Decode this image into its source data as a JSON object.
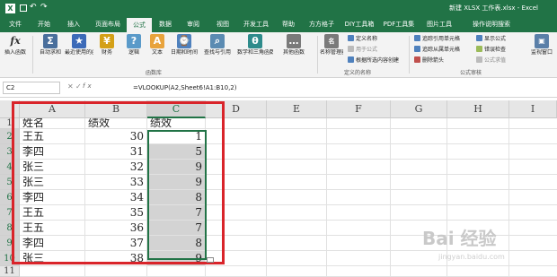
{
  "window": {
    "title": "新建 XLSX 工作表.xlsx - Excel",
    "user": "登录"
  },
  "tabs": [
    "文件",
    "开始",
    "插入",
    "页面布局",
    "公式",
    "数据",
    "审阅",
    "视图",
    "开发工具",
    "帮助",
    "方方格子",
    "DIY工具箱",
    "PDF工具集",
    "图片工具",
    "操作说明搜索"
  ],
  "ribbon": {
    "insert_function": "插入函数",
    "function_library": {
      "group_label": "函数库",
      "buttons": [
        "自动求和",
        "最近使用的函数",
        "财务",
        "逻辑",
        "文本",
        "日期和时间",
        "查找与引用",
        "数学和三角函数",
        "其他函数"
      ]
    },
    "defined_names": {
      "group_label": "定义的名称",
      "name_manager": "名称管理器",
      "items": [
        "定义名称",
        "用于公式",
        "根据所选内容创建"
      ]
    },
    "formula_auditing": {
      "group_label": "公式审核",
      "items": [
        "追踪引用单元格",
        "追踪从属单元格",
        "删除箭头",
        "显示公式",
        "错误检查",
        "公式求值"
      ],
      "watch_window": "监视窗口"
    }
  },
  "formula_bar": {
    "name_box": "C2",
    "fx_label": "fx",
    "formula": "=VLOOKUP(A2,Sheet6!A1:B10,2)"
  },
  "sheet": {
    "columns": [
      "A",
      "B",
      "C",
      "D",
      "E",
      "F",
      "G",
      "H",
      "I"
    ],
    "rows": [
      "1",
      "2",
      "3",
      "4",
      "5",
      "6",
      "7",
      "8",
      "9",
      "10",
      "11"
    ],
    "cells": [
      [
        "姓名",
        "绩效",
        "绩效"
      ],
      [
        "王五",
        "30",
        "1"
      ],
      [
        "李四",
        "31",
        "5"
      ],
      [
        "张三",
        "32",
        "9"
      ],
      [
        "张三",
        "33",
        "9"
      ],
      [
        "李四",
        "34",
        "8"
      ],
      [
        "王五",
        "35",
        "7"
      ],
      [
        "王五",
        "36",
        "7"
      ],
      [
        "李四",
        "37",
        "8"
      ],
      [
        "张三",
        "38",
        "9"
      ]
    ],
    "selected_column": "C",
    "highlight_color": "#d9242a",
    "accent_color": "#217346"
  },
  "watermark": {
    "brand": "Bai 经验",
    "url": "jingyan.baidu.com"
  }
}
